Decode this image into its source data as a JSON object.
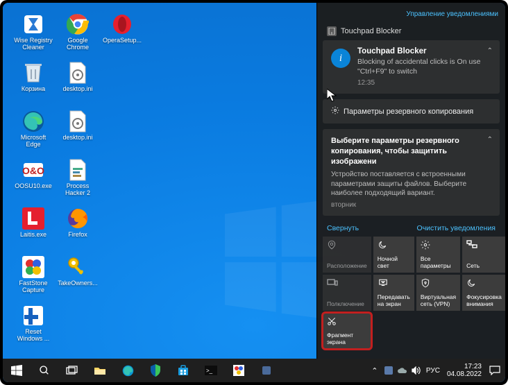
{
  "desktop_icons": [
    {
      "label": "Wise Registry Cleaner",
      "icon": "app-blue"
    },
    {
      "label": "Google Chrome",
      "icon": "chrome"
    },
    {
      "label": "OperaSetup...",
      "icon": "opera"
    },
    {
      "label": "Корзина",
      "icon": "bin"
    },
    {
      "label": "desktop.ini",
      "icon": "ini"
    },
    {
      "label": "",
      "icon": "empty"
    },
    {
      "label": "Microsoft Edge",
      "icon": "edge"
    },
    {
      "label": "desktop.ini",
      "icon": "ini"
    },
    {
      "label": "",
      "icon": "empty"
    },
    {
      "label": "OOSU10.exe",
      "icon": "oo"
    },
    {
      "label": "Process Hacker 2",
      "icon": "ph"
    },
    {
      "label": "",
      "icon": "empty"
    },
    {
      "label": "Laitis.exe",
      "icon": "laitis"
    },
    {
      "label": "Firefox",
      "icon": "firefox"
    },
    {
      "label": "",
      "icon": "empty"
    },
    {
      "label": "FastStone Capture",
      "icon": "faststone"
    },
    {
      "label": "TakeOwners...",
      "icon": "key"
    },
    {
      "label": "",
      "icon": "empty"
    },
    {
      "label": "Reset Windows ...",
      "icon": "reset"
    },
    {
      "label": "",
      "icon": "empty"
    },
    {
      "label": "",
      "icon": "empty"
    }
  ],
  "action_center": {
    "manage_label": "Управление уведомлениями",
    "app_name": "Touchpad Blocker",
    "notif1": {
      "title": "Touchpad Blocker",
      "text": "Blocking of accidental clicks is On use \"Ctrl+F9\" to switch",
      "time": "12:35"
    },
    "settings_header": "Параметры резервного копирования",
    "backup": {
      "title": "Выберите параметры резервного копирования, чтобы защитить изображени",
      "text": "Устройство поставляется с встроенными параметрами защиты файлов. Выберите наиболее подходящий вариант.",
      "time": "вторник"
    },
    "collapse": "Свернуть",
    "clear": "Очистить уведомления",
    "quick_actions": [
      {
        "label": "Расположение",
        "icon": "location",
        "disabled": true
      },
      {
        "label": "Ночной свет",
        "icon": "nightlight"
      },
      {
        "label": "Все параметры",
        "icon": "settings"
      },
      {
        "label": "Сеть",
        "icon": "network"
      },
      {
        "label": "Полключение",
        "icon": "connect",
        "disabled": true
      },
      {
        "label": "Передавать на экран",
        "icon": "project"
      },
      {
        "label": "Виртуальная сеть (VPN)",
        "icon": "vpn"
      },
      {
        "label": "Фокусировка внимания",
        "icon": "focus"
      },
      {
        "label": "Фрагмент экрана",
        "icon": "snip",
        "highlight": true
      }
    ]
  },
  "taskbar": {
    "lang": "РУС",
    "time": "17:23",
    "date": "04.08.2022"
  }
}
